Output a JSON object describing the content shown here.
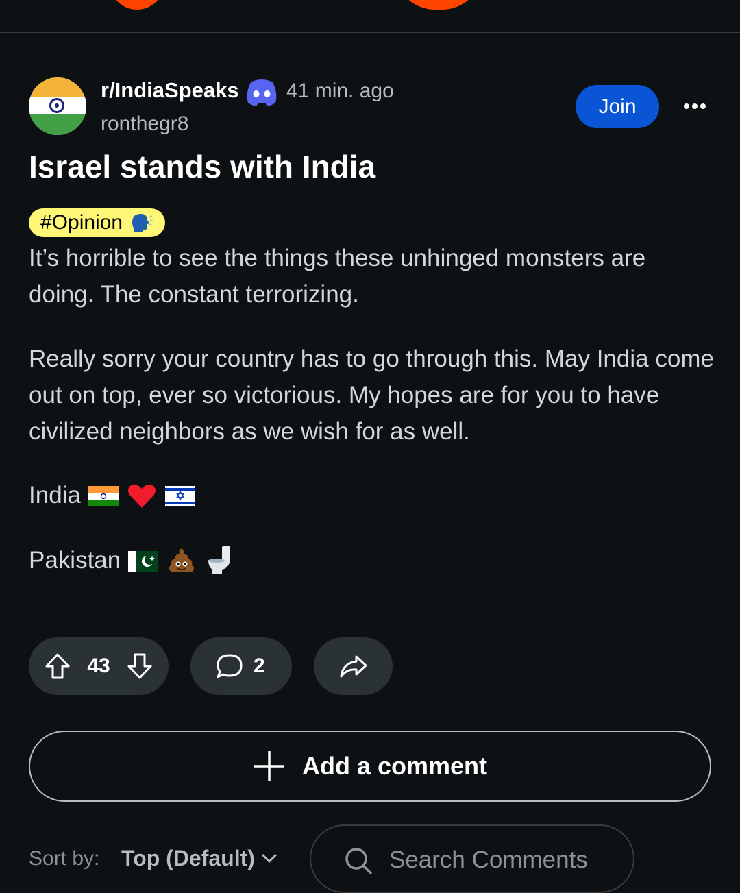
{
  "post": {
    "subreddit": "r/IndiaSpeaks",
    "time_ago": "41 min. ago",
    "author": "ronthegr8",
    "join_label": "Join",
    "title": "Israel stands with India",
    "flair": "#Opinion",
    "body_p1": "It’s horrible to see the things these unhinged monsters are doing. The constant terrorizing.",
    "body_p2": "Really sorry your country has to go through this. May India come out on top, ever so victorious. My hopes are for you to have civilized neighbors as we wish for as well.",
    "line3_text": "India",
    "line4_text": "Pakistan"
  },
  "actions": {
    "vote_count": "43",
    "comment_count": "2"
  },
  "add_comment_label": "Add a comment",
  "sort": {
    "label": "Sort by:",
    "value": "Top (Default)"
  },
  "search": {
    "placeholder": "Search Comments"
  },
  "icons": [
    "discord-icon",
    "speaking-head-icon",
    "india-flag-icon",
    "red-heart-icon",
    "israel-flag-icon",
    "pakistan-flag-icon",
    "poop-icon",
    "toilet-icon",
    "upvote-icon",
    "downvote-icon",
    "comment-icon",
    "share-icon",
    "plus-icon",
    "chevron-down-icon",
    "search-icon"
  ],
  "colors": {
    "background": "#0e1113",
    "accent_join": "#0a55d6",
    "flair_bg": "#fff876",
    "pill_bg": "#2a3236",
    "brand": "#ff4500"
  }
}
